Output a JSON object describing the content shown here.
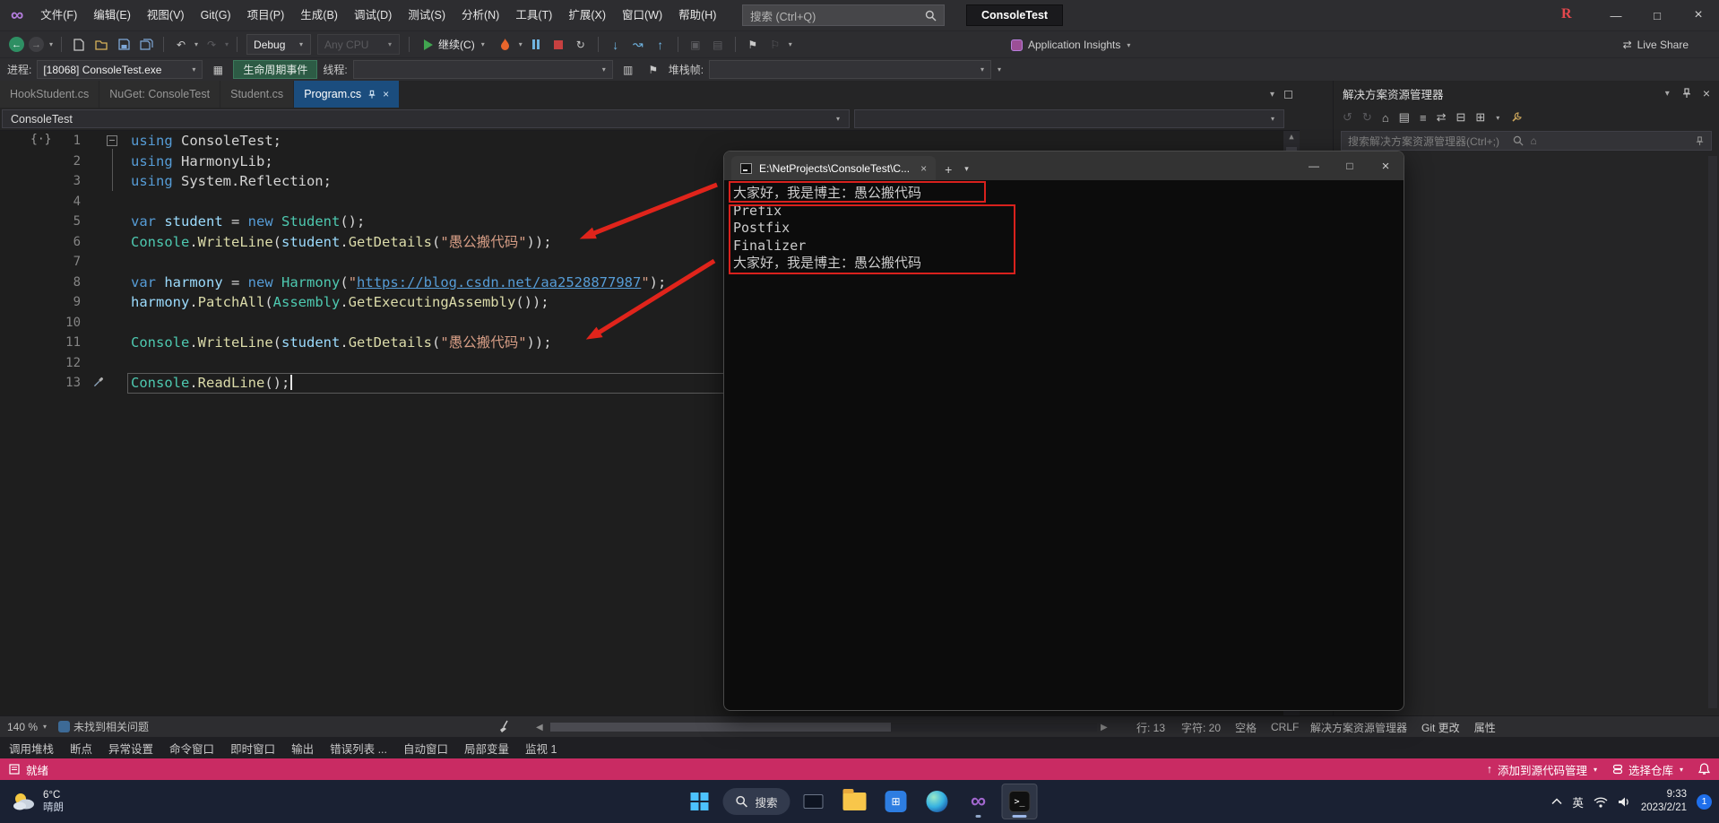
{
  "colors": {
    "status_bar": "#C92B63",
    "active_tab": "#1B4D7E",
    "annotation_red": "#D8211D",
    "kw": "#569CD6",
    "cl": "#4EC9B0",
    "vr": "#9CDCFE",
    "mt": "#DCDCAA",
    "st": "#D69D85",
    "lk": "#569CD6"
  },
  "titlebar": {
    "menus": [
      "文件(F)",
      "编辑(E)",
      "视图(V)",
      "Git(G)",
      "项目(P)",
      "生成(B)",
      "调试(D)",
      "测试(S)",
      "分析(N)",
      "工具(T)",
      "扩展(X)",
      "窗口(W)",
      "帮助(H)"
    ],
    "search_placeholder": "搜索 (Ctrl+Q)",
    "solution_badge": "ConsoleTest",
    "extension_badge": "R"
  },
  "toolbar": {
    "config": "Debug",
    "platform": "Any CPU",
    "continue_label": "继续(C)",
    "app_insights_label": "Application Insights",
    "live_share_label": "Live Share"
  },
  "debugbar": {
    "process_label": "进程:",
    "process_value": "[18068] ConsoleTest.exe",
    "lifecycle_button": "生命周期事件",
    "thread_label": "线程:",
    "stack_label": "堆栈帧:"
  },
  "editor_tabs": [
    {
      "label": "HookStudent.cs",
      "active": false
    },
    {
      "label": "NuGet: ConsoleTest",
      "active": false
    },
    {
      "label": "Student.cs",
      "active": false
    },
    {
      "label": "Program.cs",
      "active": true
    }
  ],
  "navbar": {
    "project": "ConsoleTest"
  },
  "code": {
    "lines": [
      {
        "n": 1,
        "fold": true,
        "tokens": [
          [
            "kw",
            "using"
          ],
          [
            "pl",
            " ConsoleTest;"
          ]
        ]
      },
      {
        "n": 2,
        "tokens": [
          [
            "kw",
            "using"
          ],
          [
            "pl",
            " HarmonyLib;"
          ]
        ]
      },
      {
        "n": 3,
        "tokens": [
          [
            "kw",
            "using"
          ],
          [
            "pl",
            " System.Reflection;"
          ]
        ]
      },
      {
        "n": 4,
        "tokens": []
      },
      {
        "n": 5,
        "tokens": [
          [
            "kw",
            "var"
          ],
          [
            "pl",
            " "
          ],
          [
            "vr",
            "student"
          ],
          [
            "pl",
            " = "
          ],
          [
            "kw",
            "new"
          ],
          [
            "pl",
            " "
          ],
          [
            "cl",
            "Student"
          ],
          [
            "pl",
            "();"
          ]
        ]
      },
      {
        "n": 6,
        "tokens": [
          [
            "cl",
            "Console"
          ],
          [
            "pl",
            "."
          ],
          [
            "mt",
            "WriteLine"
          ],
          [
            "pl",
            "("
          ],
          [
            "vr",
            "student"
          ],
          [
            "pl",
            "."
          ],
          [
            "mt",
            "GetDetails"
          ],
          [
            "pl",
            "("
          ],
          [
            "st",
            "\"愚公搬代码\""
          ],
          [
            "pl",
            "));"
          ]
        ]
      },
      {
        "n": 7,
        "tokens": []
      },
      {
        "n": 8,
        "tokens": [
          [
            "kw",
            "var"
          ],
          [
            "pl",
            " "
          ],
          [
            "vr",
            "harmony"
          ],
          [
            "pl",
            " = "
          ],
          [
            "kw",
            "new"
          ],
          [
            "pl",
            " "
          ],
          [
            "cl",
            "Harmony"
          ],
          [
            "pl",
            "("
          ],
          [
            "st",
            "\""
          ],
          [
            "lk",
            "https://blog.csdn.net/aa2528877987"
          ],
          [
            "st",
            "\""
          ],
          [
            "pl",
            ");"
          ]
        ]
      },
      {
        "n": 9,
        "tokens": [
          [
            "vr",
            "harmony"
          ],
          [
            "pl",
            "."
          ],
          [
            "mt",
            "PatchAll"
          ],
          [
            "pl",
            "("
          ],
          [
            "cl",
            "Assembly"
          ],
          [
            "pl",
            "."
          ],
          [
            "mt",
            "GetExecutingAssembly"
          ],
          [
            "pl",
            "());"
          ]
        ]
      },
      {
        "n": 10,
        "tokens": []
      },
      {
        "n": 11,
        "tokens": [
          [
            "cl",
            "Console"
          ],
          [
            "pl",
            "."
          ],
          [
            "mt",
            "WriteLine"
          ],
          [
            "pl",
            "("
          ],
          [
            "vr",
            "student"
          ],
          [
            "pl",
            "."
          ],
          [
            "mt",
            "GetDetails"
          ],
          [
            "pl",
            "("
          ],
          [
            "st",
            "\"愚公搬代码\""
          ],
          [
            "pl",
            "));"
          ]
        ]
      },
      {
        "n": 12,
        "tokens": []
      },
      {
        "n": 13,
        "current": true,
        "tool": true,
        "tokens": [
          [
            "cl",
            "Console"
          ],
          [
            "pl",
            "."
          ],
          [
            "mt",
            "ReadLine"
          ],
          [
            "pl",
            "();"
          ]
        ]
      }
    ]
  },
  "console": {
    "tab_title": "E:\\NetProjects\\ConsoleTest\\C...",
    "lines": [
      "大家好，我是博主：愚公搬代码",
      "Prefix",
      "Postfix",
      "Finalizer",
      "大家好，我是博主：愚公搬代码"
    ]
  },
  "solution_explorer": {
    "title": "解决方案资源管理器",
    "search_placeholder": "搜索解决方案资源管理器(Ctrl+;)"
  },
  "stripbar": {
    "zoom": "140 %",
    "health_text": "未找到相关问题",
    "line_info": "行: 13",
    "char_info": "字符: 20",
    "space_label": "空格",
    "eol_label": "CRLF",
    "dock_tabs": [
      "解决方案资源管理器",
      "Git 更改",
      "属性"
    ]
  },
  "bottom_tabs": [
    "调用堆栈",
    "断点",
    "异常设置",
    "命令窗口",
    "即时窗口",
    "输出",
    "错误列表 ...",
    "自动窗口",
    "局部变量",
    "监视 1"
  ],
  "statusbar": {
    "ready": "就绪",
    "add_scc": "添加到源代码管理",
    "select_repo": "选择仓库"
  },
  "taskbar": {
    "weather_temp": "6°C",
    "weather_text": "晴朗",
    "search_label": "搜索",
    "ime": "英",
    "time": "9:33",
    "date": "2023/2/21",
    "badge": "1"
  }
}
